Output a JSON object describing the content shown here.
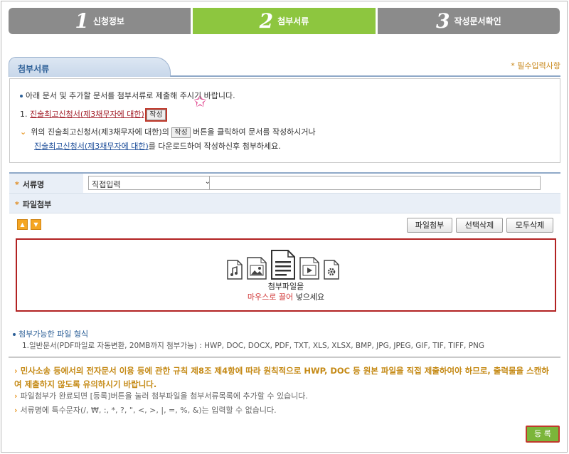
{
  "steps": [
    {
      "num": "1",
      "label": "신청정보"
    },
    {
      "num": "2",
      "label": "첨부서류"
    },
    {
      "num": "3",
      "label": "작성문서확인"
    }
  ],
  "section": {
    "tab_title": "첨부서류",
    "required_note": "* 필수입력사항"
  },
  "info": {
    "intro": "아래 문서 및 추가할 문서를 첨부서류로 제출해 주시기 바랍니다.",
    "item_prefix": "1.",
    "item_link": "진술최고신청서(제3채무자에 대한)",
    "write_btn": "작성",
    "guide_line1_a": "위의 진술최고신청서(제3채무자에 대한)의",
    "guide_line1_b": "버튼을 클릭하여 문서를 작성하시거나",
    "guide_line2_link": "진술최고신청서(제3채무자에 대한)",
    "guide_line2_rest": "를 다운로드하여 작성하신후 첨부하세요."
  },
  "form": {
    "doc_name_label": "서류명",
    "doc_name_select": "직접입력",
    "doc_name_input": "",
    "file_attach_label": "파일첨부"
  },
  "toolbar": {
    "attach": "파일첨부",
    "delete_selected": "선택삭제",
    "delete_all": "모두삭제"
  },
  "dropzone": {
    "line1": "첨부파일을",
    "line2_red": "마우스로 끌어",
    "line2_rest": " 넣으세요"
  },
  "formats": {
    "title": "첨부가능한 파일 형식",
    "list": "1.일반문서(PDF파일로 자동변환, 20MB까지 첨부가능) : HWP, DOC, DOCX, PDF, TXT, XLS, XLSX, BMP, JPG, JPEG, GIF, TIF, TIFF, PNG"
  },
  "notes": {
    "warning": "민사소송 등에서의 전자문서 이용 등에 관한 규칙 제8조 제4항에 따라 원칙적으로 HWP, DOC 등 원본 파일을 직접 제출하여야 하므로, 출력물을 스캔하여 제출하지 않도록 유의하시기 바랍니다.",
    "note1": "파일첨부가 완료되면 [등록]버튼을 눌러 첨부파일을 첨부서류목록에 추가할 수 있습니다.",
    "note2": "서류명에 특수문자(/, ₩, :, *, ?, \", <, >, |, =, %, &)는 입력할 수 없습니다."
  },
  "submit": "등 록",
  "colors": {
    "active_step": "#8dc63f",
    "inactive_step": "#8b8b8b",
    "highlight": "#c0392b"
  }
}
